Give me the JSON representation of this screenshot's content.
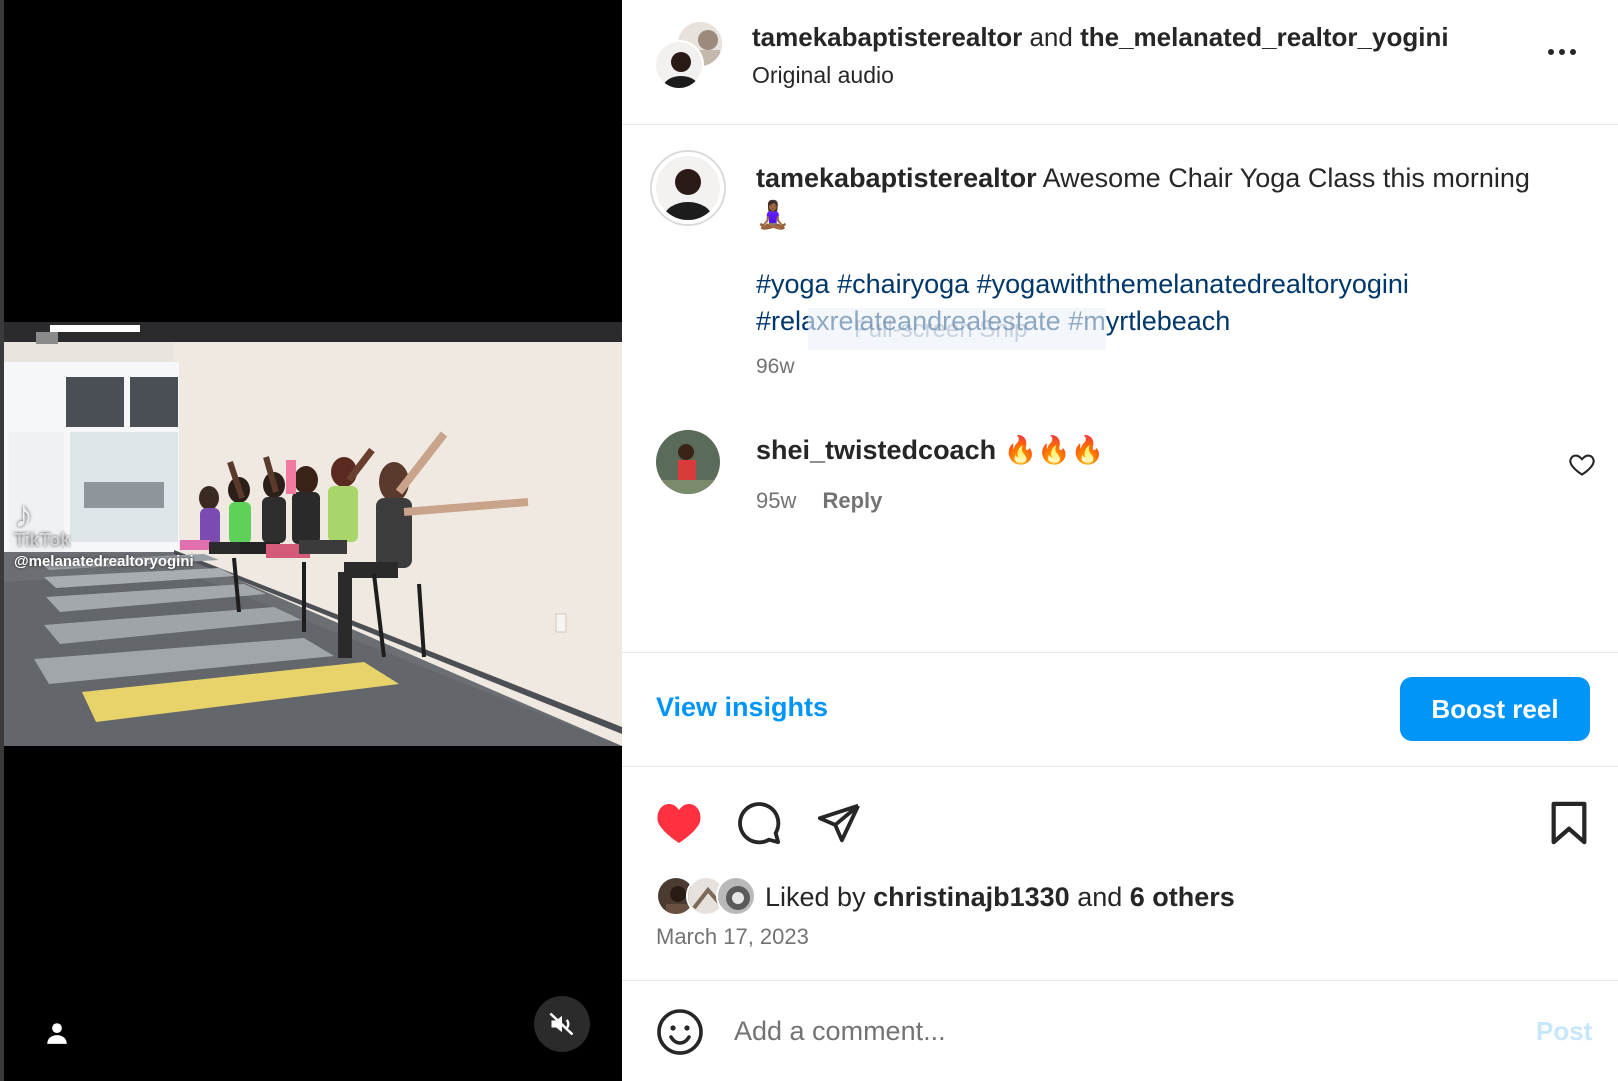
{
  "video": {
    "watermark_logo": "♪",
    "watermark_name": "TikTok",
    "watermark_handle": "@melanatedrealtoryogini",
    "muted": true
  },
  "header": {
    "author": "tamekabaptisterealtor",
    "joiner": "and",
    "collaborator": "the_melanated_realtor_yogini",
    "audio": "Original audio"
  },
  "caption": {
    "username": "tamekabaptisterealtor",
    "text": "Awesome Chair Yoga Class this morning",
    "emoji": "🧘🏾‍♀️",
    "hashtags": "#yoga #chairyoga #yogawiththemelanatedrealtoryogini #relaxrelateandrealestate #myrtlebeach",
    "time": "96w",
    "overlay_hint": "Full-screen Snip"
  },
  "comment": {
    "username": "shei_twistedcoach",
    "text": "🔥🔥🔥",
    "time": "95w",
    "reply_label": "Reply"
  },
  "insights": {
    "view_label": "View insights",
    "boost_label": "Boost reel"
  },
  "likes": {
    "prefix": "Liked by",
    "liker": "christinajb1330",
    "joiner": "and",
    "others": "6 others",
    "date": "March 17, 2023"
  },
  "add_comment": {
    "placeholder": "Add a comment...",
    "post_label": "Post"
  },
  "colors": {
    "link_blue": "#0095f6",
    "hashtag_blue": "#00376b",
    "like_red": "#ff3040",
    "muted_text": "#737373"
  },
  "icons": [
    "more-icon",
    "heart-icon",
    "comment-icon",
    "share-icon",
    "bookmark-icon",
    "emoji-icon",
    "mute-icon",
    "user-tag-icon",
    "comment-like-icon"
  ]
}
